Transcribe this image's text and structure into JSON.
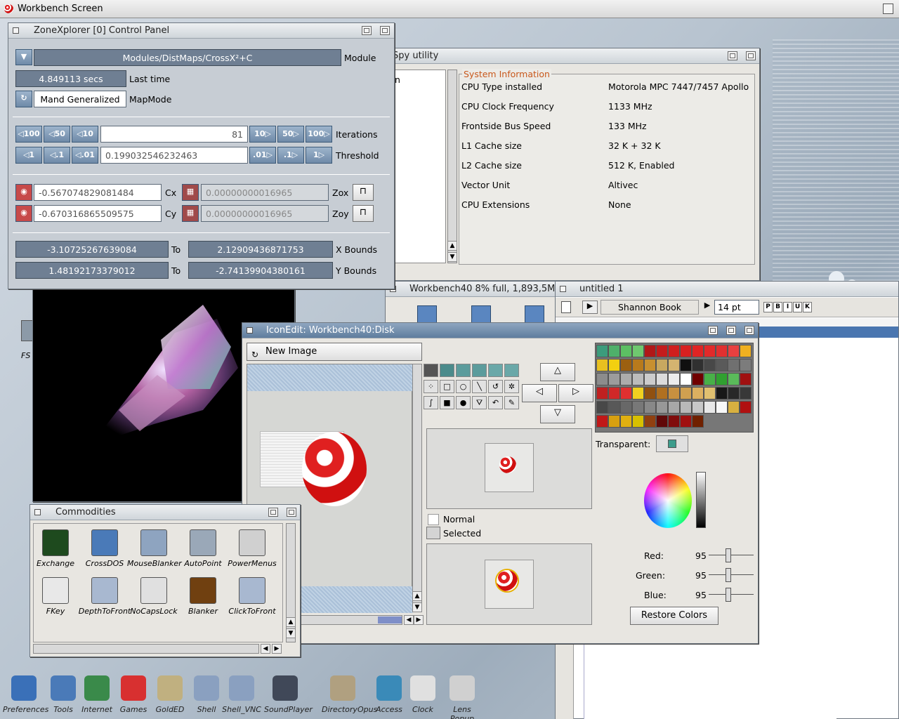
{
  "screen": {
    "title": "Workbench Screen"
  },
  "zonexplorer": {
    "title": "ZoneXplorer [0] Control Panel",
    "module_value": "Modules/DistMaps/CrossX²+C",
    "module_label": "Module",
    "last_time_value": "4.849113 secs",
    "last_time_label": "Last time",
    "mapmode_value": "Mand Generalized",
    "mapmode_label": "MapMode",
    "iter_dec_buttons": [
      "◁100",
      "◁50",
      "◁10"
    ],
    "iter_value": "81",
    "iter_inc_buttons": [
      "10▷",
      "50▷",
      "100▷"
    ],
    "iterations_label": "Iterations",
    "thr_dec_buttons": [
      "◁1",
      "◁.1",
      "◁.01"
    ],
    "threshold_value": "0.199032546232463",
    "thr_inc_buttons": [
      ".01▷",
      ".1▷",
      "1▷"
    ],
    "threshold_label": "Threshold",
    "cx_value": "-0.567074829081484",
    "cx_label": "Cx",
    "zox_value": "0.00000000016965",
    "zox_label": "Zox",
    "cy_value": "-0.670316865509575",
    "cy_label": "Cy",
    "zoy_value": "0.00000000016965",
    "zoy_label": "Zoy",
    "xmin": "-3.10725267639084",
    "xmax": "2.12909436871753",
    "to_label": "To",
    "x_bounds_label": "X Bounds",
    "ymin": "1.48192173379012",
    "ymax": "-2.74139904380161",
    "y_bounds_label": "Y Bounds"
  },
  "spy": {
    "title": "Spy utility",
    "left_item": "n",
    "group_title": "System Information",
    "rows": [
      {
        "label": "CPU Type installed",
        "value": "Motorola MPC 7447/7457 Apollo"
      },
      {
        "label": "CPU Clock Frequency",
        "value": "1133 MHz"
      },
      {
        "label": "Frontside Bus Speed",
        "value": "133 MHz"
      },
      {
        "label": "L1 Cache size",
        "value": "32 K + 32 K"
      },
      {
        "label": "L2 Cache size",
        "value": "512 K, Enabled"
      },
      {
        "label": "Vector Unit",
        "value": "Altivec"
      },
      {
        "label": "CPU Extensions",
        "value": "None"
      }
    ]
  },
  "workbench40": {
    "title": "Workbench40  8% full, 1,893,5M"
  },
  "untitled": {
    "title": "untitled 1",
    "font_name": "Shannon Book",
    "font_size": "14 pt",
    "style_buttons": [
      "P",
      "B",
      "I",
      "U",
      "K"
    ]
  },
  "iconedit": {
    "title": "IconEdit: Workbench40:Disk",
    "new_image_label": "New Image",
    "normal_label": "Normal",
    "selected_label": "Selected",
    "transparent_label": "Transparent:",
    "red_label": "Red:",
    "red_value": "95",
    "green_label": "Green:",
    "green_value": "95",
    "blue_label": "Blue:",
    "blue_value": "95",
    "restore_label": "Restore Colors",
    "arrows": [
      "△",
      "◁",
      "▷",
      "▽"
    ],
    "palette": [
      "#3c9c7c",
      "#4fb06a",
      "#5cbf63",
      "#6fc86f",
      "#b01818",
      "#c41c1c",
      "#d01e1e",
      "#d82020",
      "#e02424",
      "#e22a2a",
      "#e03030",
      "#e84040",
      "#f0b020",
      "#e8c020",
      "#f2d010",
      "#9c6010",
      "#b87a1c",
      "#c89030",
      "#c8a860",
      "#d4b470",
      "#101010",
      "#303030",
      "#484848",
      "#5a5a5a",
      "#707070",
      "#7c7c7c",
      "#8c8c8c",
      "#9c9c9c",
      "#acacac",
      "#bcbcbc",
      "#cccccc",
      "#dcdcdc",
      "#ececec",
      "#ffffff",
      "#700000",
      "#48b048",
      "#30a030",
      "#5aba5a",
      "#a01010",
      "#c02020",
      "#d02828",
      "#e03030",
      "#f0d020",
      "#905010",
      "#b07020",
      "#c89040",
      "#d0a050",
      "#dcb060",
      "#e0c070",
      "#181818",
      "#282828",
      "#383838",
      "#484848",
      "#585858",
      "#686868",
      "#787878",
      "#888888",
      "#989898",
      "#a8a8a8",
      "#b8b8b8",
      "#c8c8c8",
      "#e8e8e8",
      "#f8f8f8",
      "#d8b040",
      "#b01010",
      "#c01818",
      "#d8a010",
      "#e0b010",
      "#d8c000",
      "#904010",
      "#600808",
      "#800c0c",
      "#a01010",
      "#702000"
    ]
  },
  "commodities": {
    "title": "Commodities",
    "items": [
      "Exchange",
      "CrossDOS",
      "MouseBlanker",
      "AutoPoint",
      "PowerMenus",
      "FKey",
      "DepthToFront",
      "NoCapsLock",
      "Blanker",
      "ClickToFront"
    ]
  },
  "dock": {
    "items": [
      "Preferences",
      "Tools",
      "Internet",
      "Games",
      "GoldED",
      "Shell",
      "Shell_VNC",
      "SoundPlayer",
      "DirectoryOpus",
      "Access",
      "Clock",
      "Lens Popup"
    ]
  },
  "desktop": {
    "left_icon_label": "FS"
  }
}
